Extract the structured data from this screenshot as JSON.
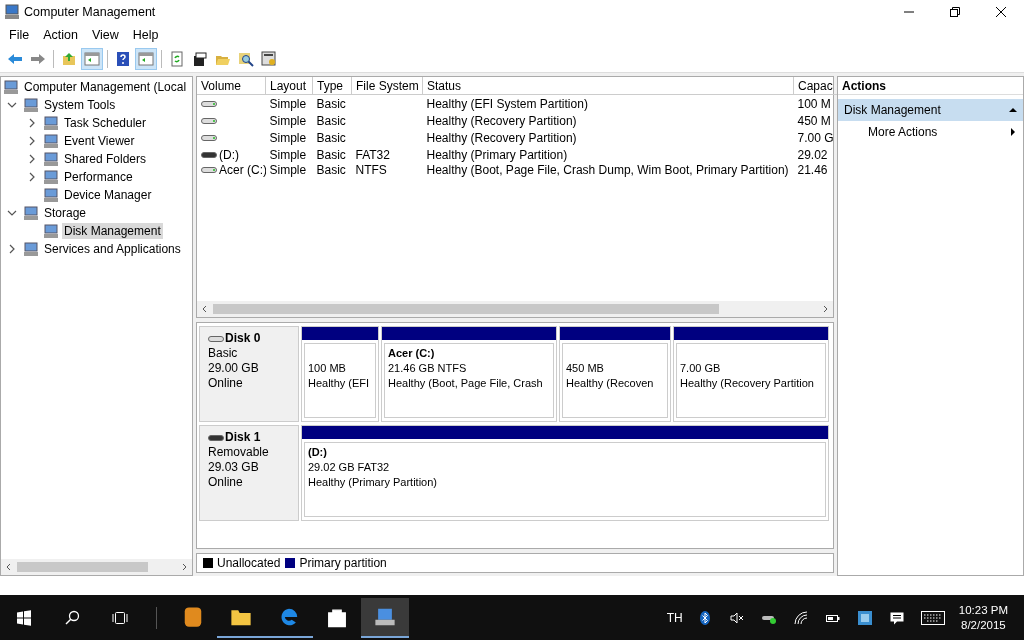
{
  "window": {
    "title": "Computer Management"
  },
  "menu": [
    "File",
    "Action",
    "View",
    "Help"
  ],
  "toolbar": [
    {
      "kind": "back",
      "pressed": false
    },
    {
      "kind": "forward",
      "pressed": false
    },
    {
      "kind": "sep"
    },
    {
      "kind": "up",
      "pressed": false
    },
    {
      "kind": "pane",
      "pressed": true
    },
    {
      "kind": "sep"
    },
    {
      "kind": "help",
      "pressed": false
    },
    {
      "kind": "pane",
      "pressed": true
    },
    {
      "kind": "sep"
    },
    {
      "kind": "refresh",
      "pressed": false
    },
    {
      "kind": "properties",
      "pressed": false
    },
    {
      "kind": "open",
      "pressed": false
    },
    {
      "kind": "find",
      "pressed": false
    },
    {
      "kind": "export",
      "pressed": false
    }
  ],
  "tree": [
    {
      "label": "Computer Management (Local",
      "selected": false,
      "children": [
        {
          "label": "System Tools",
          "expanded": true,
          "selected": false,
          "children": [
            {
              "label": "Task Scheduler",
              "expanded": false,
              "selected": false
            },
            {
              "label": "Event Viewer",
              "expanded": false,
              "selected": false
            },
            {
              "label": "Shared Folders",
              "expanded": false,
              "selected": false
            },
            {
              "label": "Performance",
              "expanded": false,
              "selected": false
            },
            {
              "label": "Device Manager",
              "selected": false
            }
          ]
        },
        {
          "label": "Storage",
          "expanded": true,
          "selected": false,
          "children": [
            {
              "label": "Disk Management",
              "selected": true
            }
          ]
        },
        {
          "label": "Services and Applications",
          "expanded": false,
          "selected": false
        }
      ]
    }
  ],
  "table": {
    "columns": [
      "Volume",
      "Layout",
      "Type",
      "File System",
      "Status",
      "Capac"
    ],
    "rows": [
      {
        "kind": "fixed",
        "cells": [
          "",
          "Simple",
          "Basic",
          "",
          "Healthy (EFI System Partition)",
          "100 M"
        ]
      },
      {
        "kind": "fixed",
        "cells": [
          "",
          "Simple",
          "Basic",
          "",
          "Healthy (Recovery Partition)",
          "450 M"
        ]
      },
      {
        "kind": "fixed",
        "cells": [
          "",
          "Simple",
          "Basic",
          "",
          "Healthy (Recovery Partition)",
          "7.00 G"
        ]
      },
      {
        "kind": "removable",
        "cells": [
          "(D:)",
          "Simple",
          "Basic",
          "FAT32",
          "Healthy (Primary Partition)",
          "29.02"
        ]
      },
      {
        "kind": "fixed",
        "cells": [
          "Acer (C:)",
          "Simple",
          "Basic",
          "NTFS",
          "Healthy (Boot, Page File, Crash Dump, Wim Boot, Primary Partition)",
          "21.46"
        ]
      }
    ]
  },
  "disks": [
    {
      "kind": "fixed",
      "name": "Disk 0",
      "type": "Basic",
      "size": "29.00 GB",
      "status": "Online",
      "partitions": [
        {
          "size": "100 MB",
          "status": "Healthy (EFI"
        },
        {
          "name": "Acer  (C:)",
          "size": "21.46 GB NTFS",
          "status": "Healthy (Boot, Page File, Crash"
        },
        {
          "size": "450 MB",
          "status": "Healthy (Recoven"
        },
        {
          "size": "7.00 GB",
          "status": "Healthy (Recovery Partition"
        }
      ]
    },
    {
      "kind": "removable",
      "name": "Disk 1",
      "type": "Removable",
      "size": "29.03 GB",
      "status": "Online",
      "partitions": [
        {
          "name": "(D:)",
          "size": "29.02 GB FAT32",
          "status": "Healthy (Primary Partition)"
        }
      ]
    }
  ],
  "legend": [
    {
      "label": "Unallocated",
      "color": "#000000"
    },
    {
      "label": "Primary partition",
      "color": "#000080"
    }
  ],
  "actions": {
    "title": "Actions",
    "section": {
      "label": "Disk Management",
      "expanded": true
    },
    "items": [
      "More Actions"
    ]
  },
  "taskbar": {
    "apps": [
      {
        "running": false,
        "selected": false
      },
      {
        "running": true,
        "selected": false
      },
      {
        "running": true,
        "selected": false
      },
      {
        "running": false,
        "selected": false
      },
      {
        "running": true,
        "selected": true
      }
    ],
    "language": "TH",
    "time": "10:23 PM",
    "date": "8/2/2015"
  }
}
